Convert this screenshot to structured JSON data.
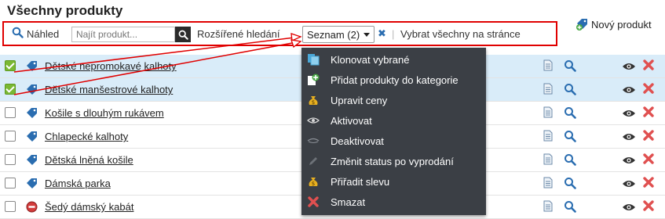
{
  "page": {
    "title": "Všechny produkty",
    "new_product_label": "Nový produkt"
  },
  "toolbar": {
    "preview_label": "Náhled",
    "search_placeholder": "Najít produkt...",
    "advanced_search_label": "Rozšířené hledání",
    "list_select_label": "Seznam (2)",
    "clear_symbol": "✖",
    "separator": "|",
    "select_all_label": "Vybrat všechny na stránce"
  },
  "products": [
    {
      "name": "Dětské nepromokavé kalhoty",
      "checked": true,
      "icon": "tag-icon"
    },
    {
      "name": "Dětské manšestrové kalhoty",
      "checked": true,
      "icon": "tag-icon"
    },
    {
      "name": "Košile s dlouhým rukávem",
      "checked": false,
      "icon": "tag-icon"
    },
    {
      "name": "Chlapecké kalhoty",
      "checked": false,
      "icon": "tag-icon"
    },
    {
      "name": "Dětská lněná košile",
      "checked": false,
      "icon": "tag-icon"
    },
    {
      "name": "Dámská parka",
      "checked": false,
      "icon": "tag-icon"
    },
    {
      "name": "Šedý dámský kabát",
      "checked": false,
      "icon": "no-entry-icon"
    }
  ],
  "bulk_menu": {
    "items": [
      {
        "label": "Klonovat vybrané",
        "icon": "clone-icon"
      },
      {
        "label": "Přidat produkty do kategorie",
        "icon": "add-to-category-icon"
      },
      {
        "label": "Upravit ceny",
        "icon": "money-bag-icon"
      },
      {
        "label": "Aktivovat",
        "icon": "eye-icon"
      },
      {
        "label": "Deaktivovat",
        "icon": "eye-closed-icon"
      },
      {
        "label": "Změnit status po vyprodání",
        "icon": "pencil-icon"
      },
      {
        "label": "Přiřadit slevu",
        "icon": "money-bag-icon"
      },
      {
        "label": "Smazat",
        "icon": "delete-icon"
      }
    ]
  },
  "colors": {
    "annotation_red": "#e00000",
    "selected_row": "#d9ecf9",
    "menu_bg": "#3b3f45",
    "accent_blue": "#2a6db0",
    "delete_red": "#e05050",
    "check_green": "#7ab833"
  }
}
